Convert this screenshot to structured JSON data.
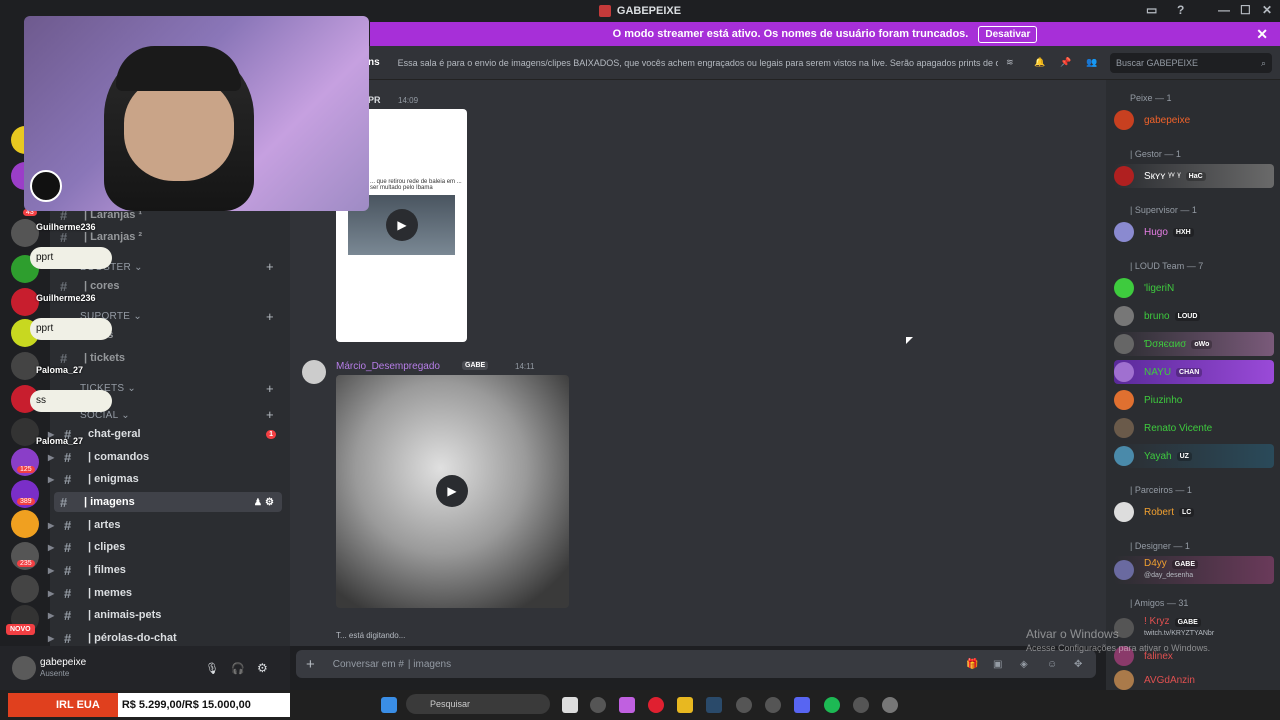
{
  "window": {
    "title": "GABEPEIXE"
  },
  "banner": {
    "text": "O modo streamer está ativo. Os nomes de usuário foram truncados.",
    "button": "Desativar"
  },
  "header": {
    "channel_fragment": "ns",
    "topic": "Essa sala é para o envio de imagens/clipes BAIXADOS, que vocês achem engraçados ou legais para serem vistos na live. Serão apagados prints de o...",
    "search_placeholder": "Buscar GABEPEIXE"
  },
  "sidebar": {
    "categories": [
      {
        "label": "BOOSTER"
      },
      {
        "label": "SUPORTE"
      },
      {
        "label": "TICKETS"
      },
      {
        "label": "SOCIAL"
      }
    ],
    "partial_channels": [
      "| Laranjas ¹",
      "| Laranjas ²",
      "| cores",
      "staffs",
      "| tickets"
    ],
    "channels": [
      {
        "label": "chat-geral",
        "mention_count": "1"
      },
      {
        "label": "| comandos"
      },
      {
        "label": "| enigmas"
      },
      {
        "label": "| imagens",
        "selected": true
      },
      {
        "label": "| artes"
      },
      {
        "label": "| clipes"
      },
      {
        "label": "| filmes"
      },
      {
        "label": "| memes"
      },
      {
        "label": "| animais-pets"
      },
      {
        "label": "| pérolas-do-chat"
      }
    ],
    "new_badge": "NOVO"
  },
  "user_panel": {
    "username": "gabepeixe",
    "status": "Ausente"
  },
  "messages": [
    {
      "author": "PR",
      "time": "14:09",
      "embed_text": "... que retirou rede de baleia em ... ser multado pelo Ibama"
    },
    {
      "author": "Márcio_Desempregado",
      "tag": "GABE",
      "time": "14:11"
    }
  ],
  "typing": {
    "text": "T... está digitando..."
  },
  "composer": {
    "placeholder": "Conversar em #",
    "channel": "| imagens"
  },
  "members": {
    "groups": [
      {
        "header": "Peixe — 1",
        "members": [
          {
            "name": "gabepeixe",
            "color": "#f0622a"
          }
        ]
      },
      {
        "header": "| Gestor — 1",
        "members": [
          {
            "name": "Sкʏʏ ᵞᵛ ᵞ",
            "color": "#dbdee1",
            "tag": "HaC"
          }
        ]
      },
      {
        "header": "| Supervisor — 1",
        "members": [
          {
            "name": "Hugo",
            "color": "#e67ee5",
            "tag": "HXH"
          }
        ]
      },
      {
        "header": "| LOUD Team — 7",
        "members": [
          {
            "name": "'ligeriN",
            "color": "#3ecb3e"
          },
          {
            "name": "bruno",
            "color": "#3ecb3e",
            "tag": "LOUD"
          },
          {
            "name": "Ɗσяєαиσ",
            "color": "#3ecb3e",
            "tag": "oWo"
          },
          {
            "name": "NAYU",
            "color": "#3ecb3e",
            "tag": "CHAN"
          },
          {
            "name": "Piuzinho",
            "color": "#3ecb3e"
          },
          {
            "name": "Renato Vicente",
            "color": "#3ecb3e"
          },
          {
            "name": "Yayah",
            "color": "#3ecb3e",
            "tag": "UZ"
          }
        ]
      },
      {
        "header": "| Parceiros — 1",
        "members": [
          {
            "name": "Robert",
            "color": "#f0a030",
            "tag": "LC"
          }
        ]
      },
      {
        "header": "| Designer — 1",
        "members": [
          {
            "name": "D4yy",
            "color": "#f0a030",
            "tag": "GABE",
            "sub": "@day_desenha"
          }
        ]
      },
      {
        "header": "| Amigos — 31",
        "members": [
          {
            "name": "! Kryz",
            "color": "#e05050",
            "tag": "GABE",
            "sub": "twitch.tv/KRYZTYANbr"
          },
          {
            "name": "falinex",
            "color": "#e05050"
          },
          {
            "name": "AVGdAnzin",
            "color": "#e05050"
          }
        ]
      }
    ]
  },
  "overlay": {
    "chat": [
      {
        "user": "Guilherme236",
        "msg": "pprt"
      },
      {
        "user": "Guilherme236",
        "msg": "pprt"
      },
      {
        "user": "Paloma_27",
        "msg": "ss"
      },
      {
        "user": "Paloma_27",
        "msg": ""
      }
    ],
    "goal": {
      "label": "IRL EUA",
      "value": "R$ 5.299,00/R$ 15.000,00"
    },
    "activation": {
      "line1": "Ativar o Windows",
      "line2": "Acesse Configurações para ativar o Windows."
    }
  },
  "taskbar": {
    "search_placeholder": "Pesquisar"
  },
  "server_badges": [
    "43",
    "125",
    "389",
    "235"
  ],
  "colors": {
    "accent": "#a72fd8",
    "background": "#313338",
    "sidebar": "#2b2d31"
  }
}
